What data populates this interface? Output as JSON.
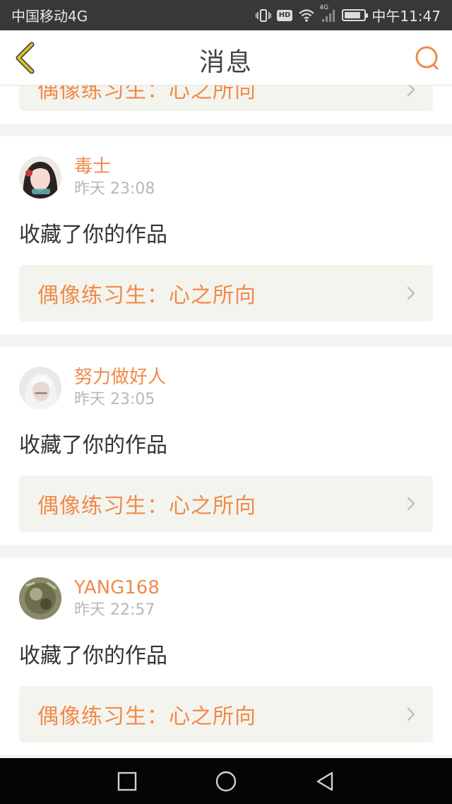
{
  "status_bar": {
    "carrier": "中国移动4G",
    "hd_label": "HD",
    "network_label": "4G",
    "time": "中午11:47",
    "battery_level": 0.85
  },
  "header": {
    "title": "消息"
  },
  "icons": {
    "back": "chevron-left-icon",
    "search": "search-icon",
    "item_arrow": "chevron-right-icon",
    "sys_recent": "square-icon",
    "sys_home": "circle-icon",
    "sys_back": "triangle-back-icon"
  },
  "colors": {
    "accent": "#f08a4b",
    "back_arrow": "#c8b41e",
    "link_background": "#f4f4ee"
  },
  "partial_item": {
    "work_title": "偶像练习生：心之所向"
  },
  "notifications": [
    {
      "username": "毒士",
      "time": "昨天 23:08",
      "action": "收藏了你的作品",
      "work_title": "偶像练习生：心之所向"
    },
    {
      "username": "努力做好人",
      "time": "昨天 23:05",
      "action": "收藏了你的作品",
      "work_title": "偶像练习生：心之所向"
    },
    {
      "username": "YANG168",
      "time": "昨天 22:57",
      "action": "收藏了你的作品",
      "work_title": "偶像练习生：心之所向"
    }
  ]
}
